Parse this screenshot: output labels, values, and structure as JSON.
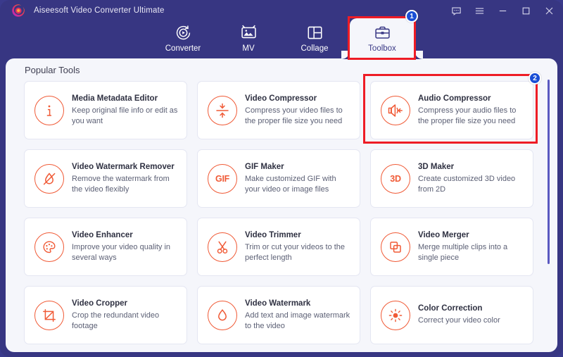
{
  "window": {
    "app_title": "Aiseesoft Video Converter Ultimate",
    "logo": "aiseesoft-swirl-logo",
    "controls": [
      {
        "name": "feedback-icon",
        "label": "Feedback"
      },
      {
        "name": "menu-icon",
        "label": "Menu"
      },
      {
        "name": "minimize-icon",
        "label": "Minimize"
      },
      {
        "name": "maximize-icon",
        "label": "Maximize"
      },
      {
        "name": "close-icon",
        "label": "Close"
      }
    ],
    "colors": {
      "titlebar_bg": "#373682",
      "panel_bg": "#f5f6fb",
      "accent_orange": "#f05a36",
      "highlight_red": "#ee1c25",
      "badge_blue": "#1a4fd6",
      "scrollbar": "#5a58c0"
    }
  },
  "tabs": [
    {
      "label": "Converter",
      "icon": "converter-icon",
      "active": false
    },
    {
      "label": "MV",
      "icon": "mv-icon",
      "active": false
    },
    {
      "label": "Collage",
      "icon": "collage-icon",
      "active": false
    },
    {
      "label": "Toolbox",
      "icon": "toolbox-icon",
      "active": true
    }
  ],
  "annotations": {
    "badge_1": "1",
    "badge_2": "2"
  },
  "main": {
    "section_title": "Popular Tools",
    "tools": [
      {
        "name": "Media Metadata Editor",
        "desc": "Keep original file info or edit as you want",
        "icon": "info-circle-icon"
      },
      {
        "name": "Video Compressor",
        "desc": "Compress your video files to the proper file size you need",
        "icon": "compress-icon"
      },
      {
        "name": "Audio Compressor",
        "desc": "Compress your audio files to the proper file size you need",
        "icon": "speaker-compress-icon"
      },
      {
        "name": "Video Watermark Remover",
        "desc": "Remove the watermark from the video flexibly",
        "icon": "no-watermark-icon"
      },
      {
        "name": "GIF Maker",
        "desc": "Make customized GIF with your video or image files",
        "icon": "gif-text-icon"
      },
      {
        "name": "3D Maker",
        "desc": "Create customized 3D video from 2D",
        "icon": "3d-text-icon"
      },
      {
        "name": "Video Enhancer",
        "desc": "Improve your video quality in several ways",
        "icon": "palette-icon"
      },
      {
        "name": "Video Trimmer",
        "desc": "Trim or cut your videos to the perfect length",
        "icon": "scissors-icon"
      },
      {
        "name": "Video Merger",
        "desc": "Merge multiple clips into a single piece",
        "icon": "merge-squares-icon"
      },
      {
        "name": "Video Cropper",
        "desc": "Crop the redundant video footage",
        "icon": "crop-icon"
      },
      {
        "name": "Video Watermark",
        "desc": "Add text and image watermark to the video",
        "icon": "droplet-icon"
      },
      {
        "name": "Color Correction",
        "desc": "Correct your video color",
        "icon": "sun-icon"
      }
    ]
  }
}
